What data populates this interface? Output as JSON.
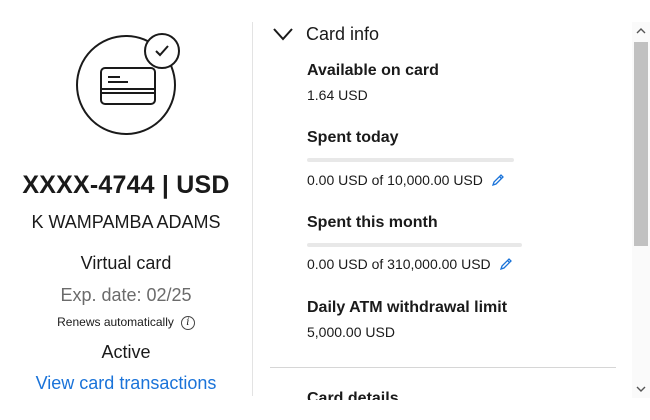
{
  "card": {
    "number": "XXXX-4744 | USD",
    "holder": "K WAMPAMBA ADAMS",
    "type": "Virtual card",
    "expiry": "Exp. date: 02/25",
    "renews": "Renews automatically",
    "status": "Active",
    "view_transactions": "View card transactions",
    "icon": "credit-card-icon",
    "badge_icon": "check-icon"
  },
  "card_info": {
    "title": "Card info",
    "fields": [
      {
        "label": "Available on card",
        "value": "1.64 USD"
      },
      {
        "label": "Spent today",
        "value": "0.00 USD of 10,000.00 USD",
        "progress": 0
      },
      {
        "label": "Spent this month",
        "value": "0.00 USD of 310,000.00 USD",
        "progress": 0
      },
      {
        "label": "Daily ATM withdrawal limit",
        "value": "5,000.00 USD"
      }
    ],
    "next_section_title": "Card details"
  },
  "colors": {
    "accent": "#1a73d9",
    "text": "#1a1a1a",
    "muted": "#6b6b6b",
    "track": "#e8e8e8"
  }
}
